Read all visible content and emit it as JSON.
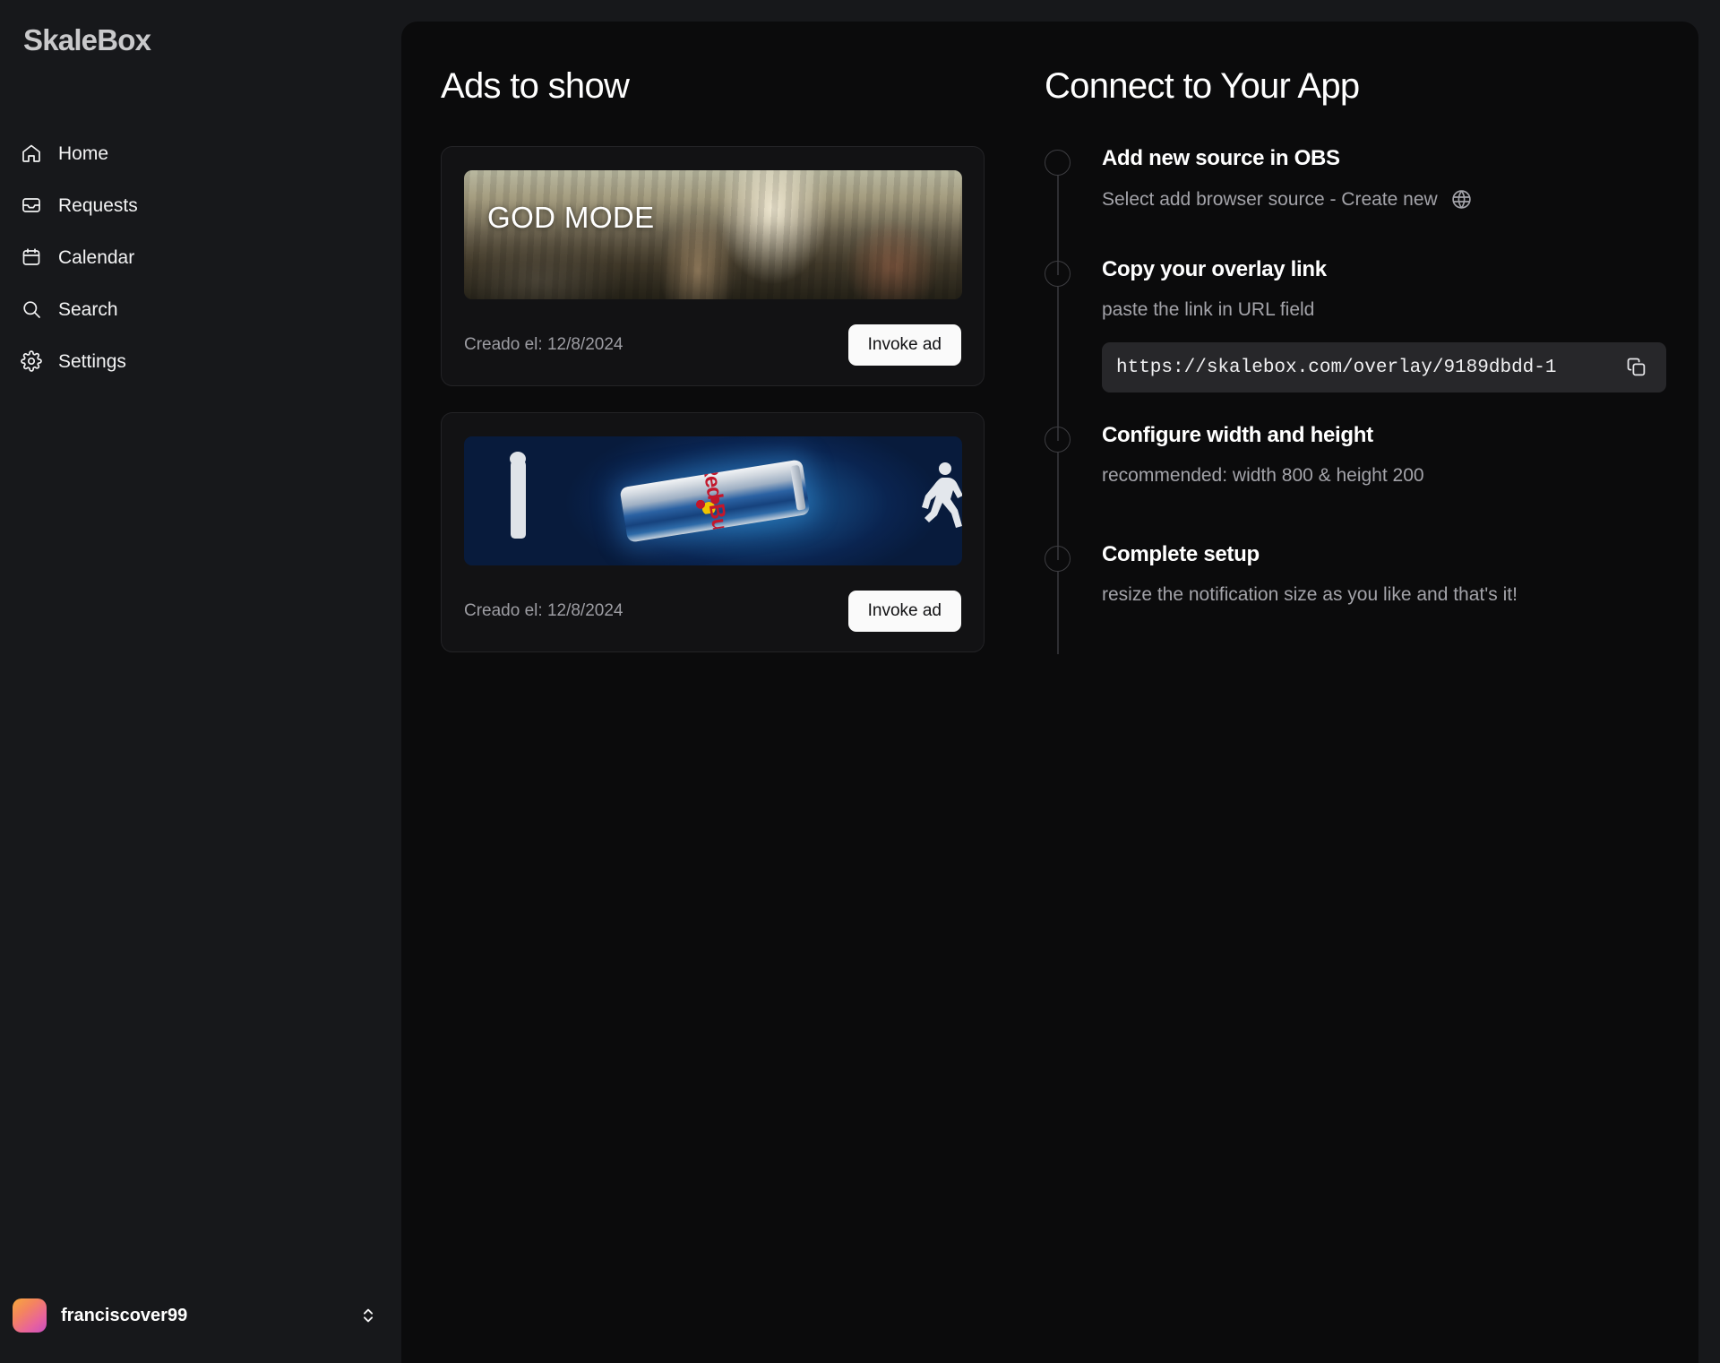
{
  "sidebar": {
    "logo": "SkaleBox",
    "items": [
      {
        "label": "Home",
        "icon": "home-icon"
      },
      {
        "label": "Requests",
        "icon": "inbox-icon"
      },
      {
        "label": "Calendar",
        "icon": "calendar-icon"
      },
      {
        "label": "Search",
        "icon": "search-icon"
      },
      {
        "label": "Settings",
        "icon": "gear-icon"
      }
    ],
    "user": {
      "name": "franciscover99",
      "avatar_gradient": [
        "#f7a83c",
        "#e8639b",
        "#c94fc0"
      ],
      "switcher_icon": "chevron-up-down-icon"
    }
  },
  "ads_panel": {
    "title": "Ads to show",
    "cards": [
      {
        "banner_label": "GOD MODE",
        "banner_kind": "painting",
        "date_label": "Creado el: 12/8/2024",
        "button_label": "Invoke ad"
      },
      {
        "banner_label": "",
        "banner_kind": "redbull",
        "banner_brand": "Red Bull",
        "date_label": "Creado el: 12/8/2024",
        "button_label": "Invoke ad"
      }
    ]
  },
  "connect_panel": {
    "title": "Connect to Your App",
    "steps": [
      {
        "title": "Add new source in OBS",
        "desc": "Select add browser source - Create new",
        "icon": "globe-icon"
      },
      {
        "title": "Copy your overlay link",
        "desc": "paste the link in URL field",
        "url_value": "https://skalebox.com/overlay/9189dbdd-1",
        "copy_icon": "copy-icon"
      },
      {
        "title": "Configure width and height",
        "desc": "recommended: width 800 & height 200"
      },
      {
        "title": "Complete setup",
        "desc": "resize the notification size as you like and that's it!"
      }
    ]
  },
  "colors": {
    "sidebar_bg": "#17181b",
    "main_bg": "#0b0b0c",
    "card_bg": "#121214",
    "card_border": "#232326",
    "button_bg": "#fafafa",
    "muted_text": "#a3a3a9",
    "input_bg": "#27272a"
  }
}
